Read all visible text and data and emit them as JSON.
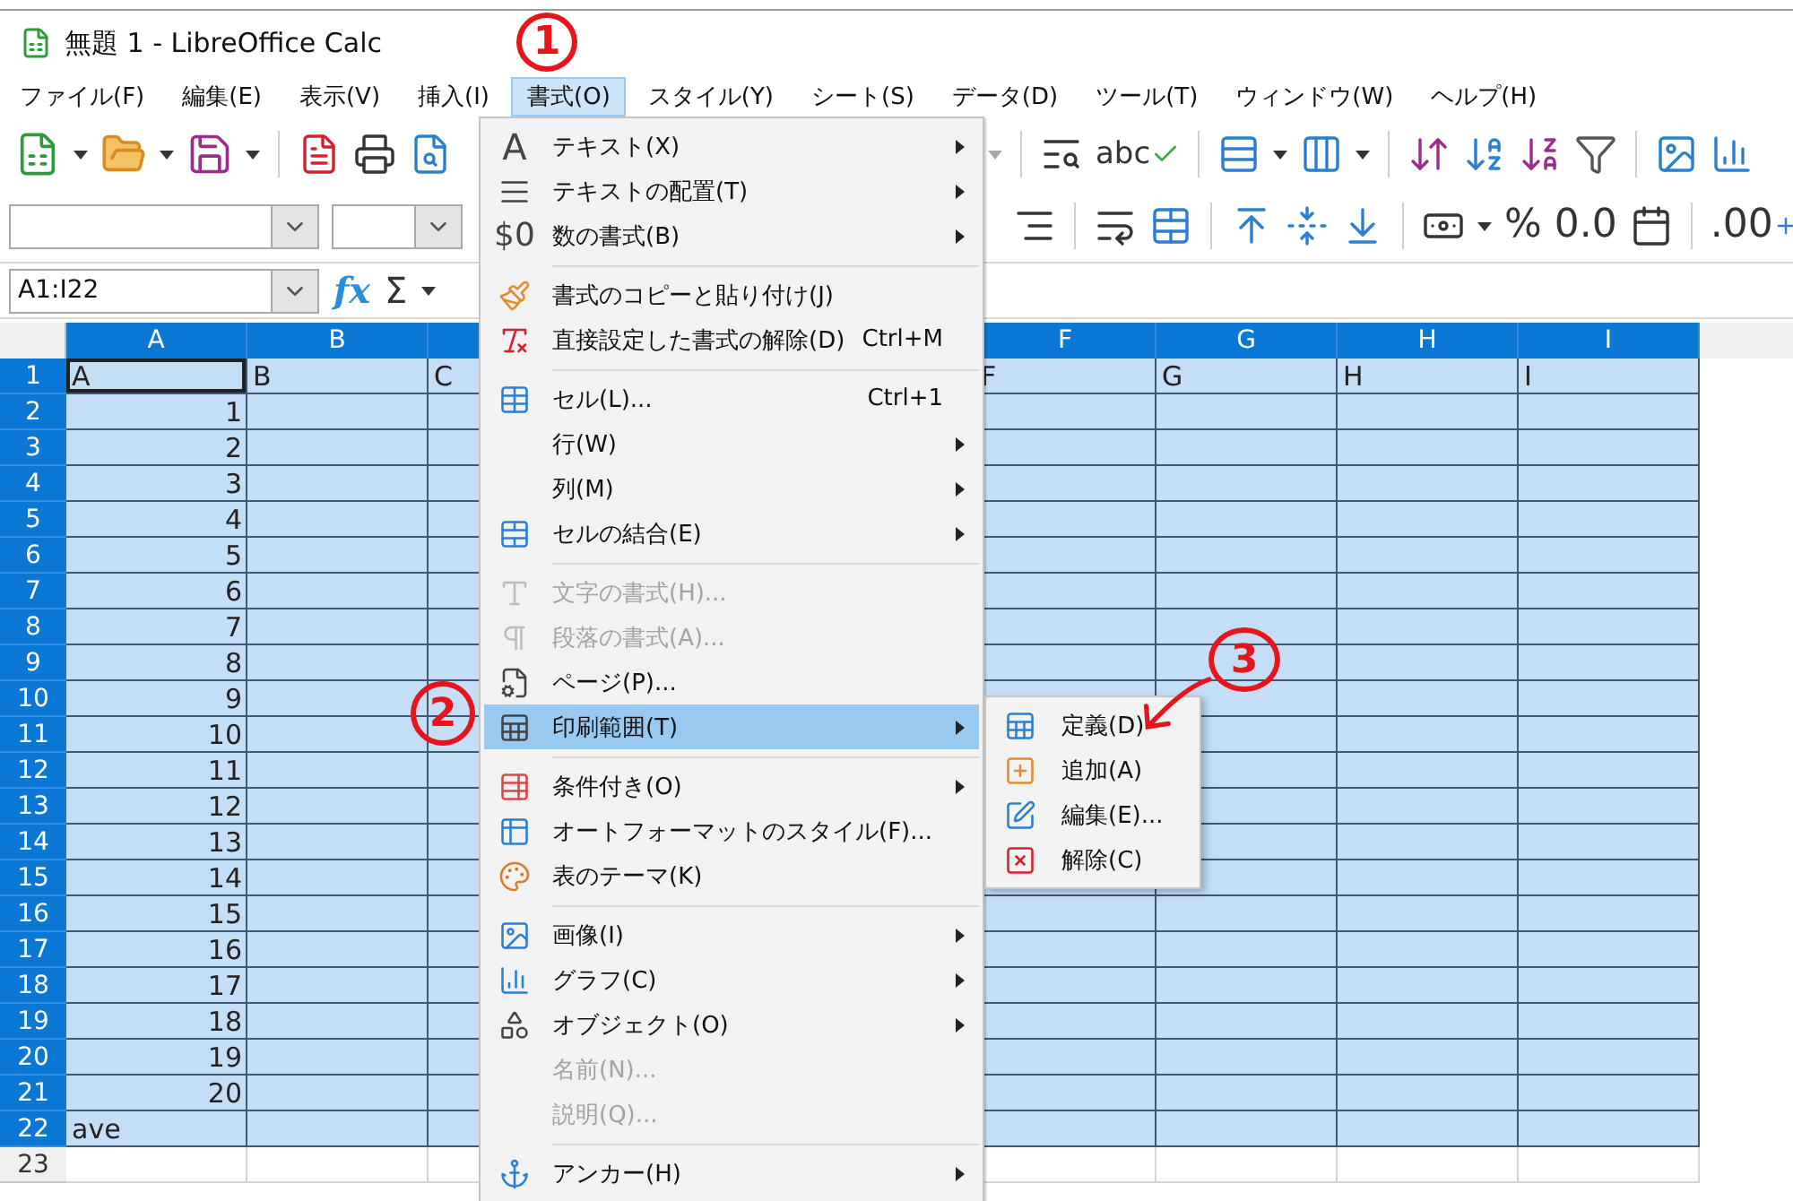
{
  "window": {
    "title": "無題 1 - LibreOffice Calc"
  },
  "menu_bar": [
    {
      "label": "ファイル(F)",
      "selected": false
    },
    {
      "label": "編集(E)",
      "selected": false
    },
    {
      "label": "表示(V)",
      "selected": false
    },
    {
      "label": "挿入(I)",
      "selected": false
    },
    {
      "label": "書式(O)",
      "selected": true
    },
    {
      "label": "スタイル(Y)",
      "selected": false
    },
    {
      "label": "シート(S)",
      "selected": false
    },
    {
      "label": "データ(D)",
      "selected": false
    },
    {
      "label": "ツール(T)",
      "selected": false
    },
    {
      "label": "ウィンドウ(W)",
      "selected": false
    },
    {
      "label": "ヘルプ(H)",
      "selected": false
    }
  ],
  "toolbar": {
    "spellcheck": "abc",
    "percent": "%",
    "decimal": "0.0",
    "add_decimal": ".00"
  },
  "formula_bar": {
    "name_box": "A1:I22",
    "function_wizard": "fx",
    "sum": "Σ"
  },
  "format_menu": {
    "items": [
      {
        "kind": "item",
        "label": "テキスト(X)",
        "icon_text": "A",
        "submenu": true,
        "disabled": false,
        "selected": false
      },
      {
        "kind": "item",
        "label": "テキストの配置(T)",
        "submenu": true,
        "disabled": false,
        "selected": false
      },
      {
        "kind": "item",
        "label": "数の書式(B)",
        "icon_text": "$0",
        "submenu": true,
        "disabled": false,
        "selected": false
      },
      {
        "kind": "separator"
      },
      {
        "kind": "item",
        "label": "書式のコピーと貼り付け(J)",
        "submenu": false,
        "disabled": false,
        "selected": false
      },
      {
        "kind": "item",
        "label": "直接設定した書式の解除(D)",
        "shortcut": "Ctrl+M",
        "submenu": false,
        "disabled": false,
        "selected": false
      },
      {
        "kind": "separator"
      },
      {
        "kind": "item",
        "label": "セル(L)...",
        "shortcut": "Ctrl+1",
        "submenu": false,
        "disabled": false,
        "selected": false
      },
      {
        "kind": "item",
        "label": "行(W)",
        "submenu": true,
        "disabled": false,
        "selected": false
      },
      {
        "kind": "item",
        "label": "列(M)",
        "submenu": true,
        "disabled": false,
        "selected": false
      },
      {
        "kind": "item",
        "label": "セルの結合(E)",
        "submenu": true,
        "disabled": false,
        "selected": false
      },
      {
        "kind": "separator"
      },
      {
        "kind": "item",
        "label": "文字の書式(H)...",
        "submenu": false,
        "disabled": true,
        "selected": false
      },
      {
        "kind": "item",
        "label": "段落の書式(A)...",
        "submenu": false,
        "disabled": true,
        "selected": false
      },
      {
        "kind": "item",
        "label": "ページ(P)...",
        "submenu": false,
        "disabled": false,
        "selected": false
      },
      {
        "kind": "item",
        "label": "印刷範囲(T)",
        "submenu": true,
        "disabled": false,
        "selected": true
      },
      {
        "kind": "separator"
      },
      {
        "kind": "item",
        "label": "条件付き(O)",
        "submenu": true,
        "disabled": false,
        "selected": false
      },
      {
        "kind": "item",
        "label": "オートフォーマットのスタイル(F)...",
        "submenu": false,
        "disabled": false,
        "selected": false
      },
      {
        "kind": "item",
        "label": "表のテーマ(K)",
        "submenu": false,
        "disabled": false,
        "selected": false
      },
      {
        "kind": "separator"
      },
      {
        "kind": "item",
        "label": "画像(I)",
        "submenu": true,
        "disabled": false,
        "selected": false
      },
      {
        "kind": "item",
        "label": "グラフ(C)",
        "submenu": true,
        "disabled": false,
        "selected": false
      },
      {
        "kind": "item",
        "label": "オブジェクト(O)",
        "submenu": true,
        "disabled": false,
        "selected": false
      },
      {
        "kind": "item",
        "label": "名前(N)...",
        "submenu": false,
        "disabled": true,
        "selected": false
      },
      {
        "kind": "item",
        "label": "説明(Q)...",
        "submenu": false,
        "disabled": true,
        "selected": false
      },
      {
        "kind": "separator"
      },
      {
        "kind": "item",
        "label": "アンカー(H)",
        "submenu": true,
        "disabled": false,
        "selected": false
      }
    ]
  },
  "print_range_submenu": {
    "items": [
      {
        "label": "定義(D)",
        "selected": false
      },
      {
        "label": "追加(A)",
        "selected": false
      },
      {
        "label": "編集(E)...",
        "selected": false
      },
      {
        "label": "解除(C)",
        "selected": false
      }
    ]
  },
  "sheet": {
    "columns": [
      {
        "label": "A",
        "selected": true
      },
      {
        "label": "B",
        "selected": true
      },
      {
        "selected": true
      },
      {
        "label": "F",
        "selected": true
      },
      {
        "label": "G",
        "selected": true
      },
      {
        "label": "H",
        "selected": true
      },
      {
        "label": "I",
        "selected": true
      }
    ],
    "rows": [
      {
        "number": "1",
        "selected": true,
        "cells": [
          {
            "text": "A",
            "active": true
          },
          {
            "text": "B",
            "active": false
          },
          {
            "text": "C",
            "active": false
          },
          {
            "text": "F",
            "active": false
          },
          {
            "text": "G",
            "active": false
          },
          {
            "text": "H",
            "active": false
          },
          {
            "text": "I",
            "active": false
          }
        ]
      },
      {
        "number": "2",
        "selected": true,
        "cells": [
          {
            "text": "1",
            "active": false
          }
        ]
      },
      {
        "number": "3",
        "selected": true,
        "cells": [
          {
            "text": "2",
            "active": false
          }
        ]
      },
      {
        "number": "4",
        "selected": true,
        "cells": [
          {
            "text": "3",
            "active": false
          }
        ]
      },
      {
        "number": "5",
        "selected": true,
        "cells": [
          {
            "text": "4",
            "active": false
          }
        ]
      },
      {
        "number": "6",
        "selected": true,
        "cells": [
          {
            "text": "5",
            "active": false
          }
        ]
      },
      {
        "number": "7",
        "selected": true,
        "cells": [
          {
            "text": "6",
            "active": false
          }
        ]
      },
      {
        "number": "8",
        "selected": true,
        "cells": [
          {
            "text": "7",
            "active": false
          }
        ]
      },
      {
        "number": "9",
        "selected": true,
        "cells": [
          {
            "text": "8",
            "active": false
          }
        ]
      },
      {
        "number": "10",
        "selected": true,
        "cells": [
          {
            "text": "9",
            "active": false
          }
        ]
      },
      {
        "number": "11",
        "selected": true,
        "cells": [
          {
            "text": "10",
            "active": false
          }
        ]
      },
      {
        "number": "12",
        "selected": true,
        "cells": [
          {
            "text": "11",
            "active": false
          }
        ]
      },
      {
        "number": "13",
        "selected": true,
        "cells": [
          {
            "text": "12",
            "active": false
          }
        ]
      },
      {
        "number": "14",
        "selected": true,
        "cells": [
          {
            "text": "13",
            "active": false
          }
        ]
      },
      {
        "number": "15",
        "selected": true,
        "cells": [
          {
            "text": "14",
            "active": false
          }
        ]
      },
      {
        "number": "16",
        "selected": true,
        "cells": [
          {
            "text": "15",
            "active": false
          }
        ]
      },
      {
        "number": "17",
        "selected": true,
        "cells": [
          {
            "text": "16",
            "active": false
          }
        ]
      },
      {
        "number": "18",
        "selected": true,
        "cells": [
          {
            "text": "17",
            "active": false
          }
        ]
      },
      {
        "number": "19",
        "selected": true,
        "cells": [
          {
            "text": "18",
            "active": false
          }
        ]
      },
      {
        "number": "20",
        "selected": true,
        "cells": [
          {
            "text": "19",
            "active": false
          }
        ]
      },
      {
        "number": "21",
        "selected": true,
        "cells": [
          {
            "text": "20",
            "active": false
          }
        ]
      },
      {
        "number": "22",
        "selected": true,
        "cells": [
          {
            "text": "ave",
            "active": false
          }
        ]
      },
      {
        "number": "23",
        "selected": false
      }
    ]
  },
  "annotations": [
    {
      "label": "1",
      "arrow": false
    },
    {
      "label": "2",
      "arrow": false
    },
    {
      "label": "3",
      "arrow": true
    }
  ]
}
